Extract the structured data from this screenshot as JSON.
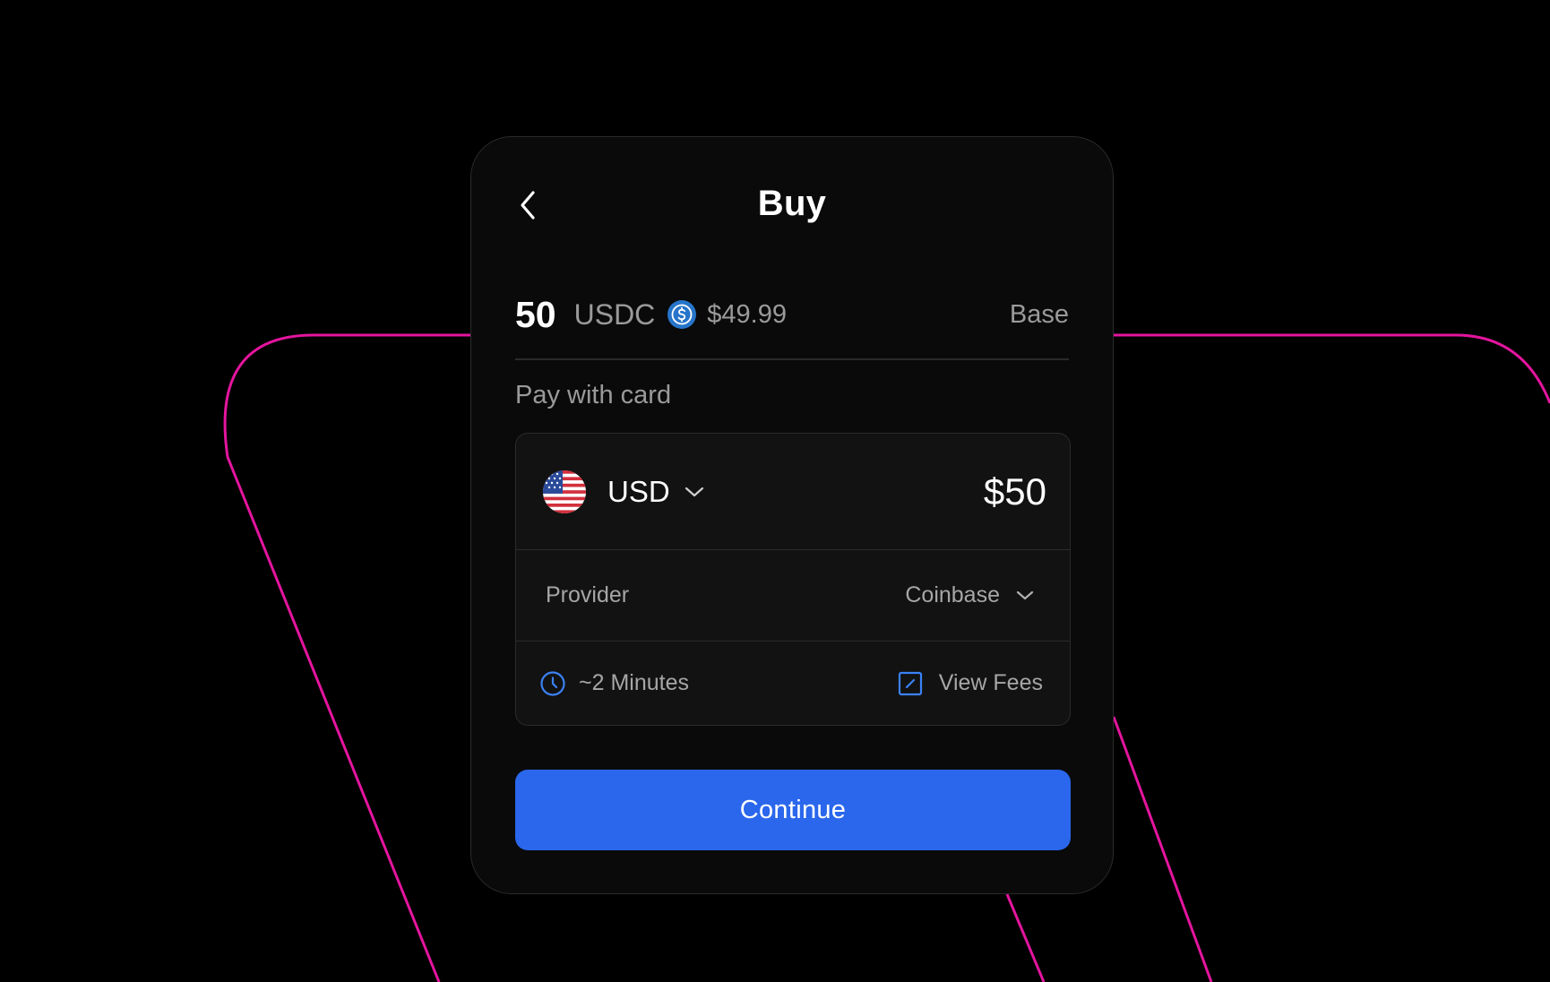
{
  "header": {
    "title": "Buy",
    "back_icon": "chevron-left-icon"
  },
  "purchase": {
    "amount": "50",
    "token": "USDC",
    "token_icon": "usdc-coin-icon",
    "fiat_equivalent": "$49.99",
    "network": "Base"
  },
  "payment": {
    "section_label": "Pay with card",
    "currency": {
      "flag_icon": "us-flag-icon",
      "code": "USD",
      "amount": "$50"
    },
    "provider": {
      "label": "Provider",
      "value": "Coinbase"
    },
    "eta": {
      "icon": "clock-icon",
      "text": "~2 Minutes"
    },
    "fees": {
      "icon": "external-link-box-icon",
      "label": "View Fees"
    }
  },
  "actions": {
    "continue_label": "Continue"
  },
  "colors": {
    "background": "#000000",
    "card": "#0a0a0a",
    "accent_blue": "#2a67ec",
    "decor_line": "#e4159e",
    "muted_text": "#9a9a9a"
  }
}
